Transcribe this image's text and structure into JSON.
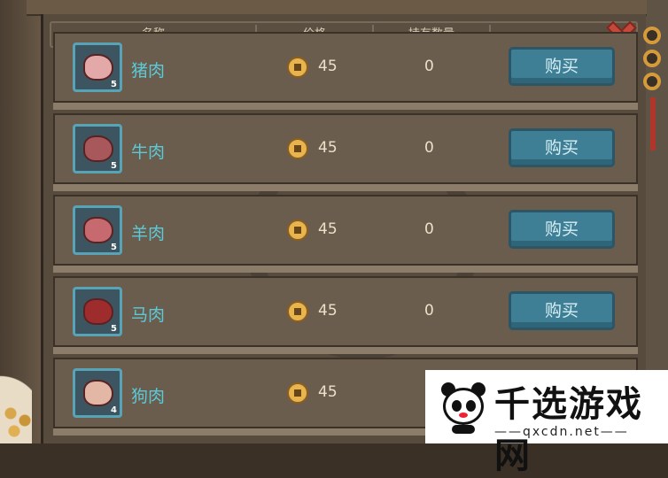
{
  "header": {
    "col_name": "名称",
    "col_price": "价格",
    "col_owned": "持有数量"
  },
  "items": [
    {
      "name": "猪肉",
      "stack": "5",
      "price": "45",
      "owned": "0",
      "buy_label": "购买",
      "meat_color": "#e3a9a9"
    },
    {
      "name": "牛肉",
      "stack": "5",
      "price": "45",
      "owned": "0",
      "buy_label": "购买",
      "meat_color": "#a8585a"
    },
    {
      "name": "羊肉",
      "stack": "5",
      "price": "45",
      "owned": "0",
      "buy_label": "购买",
      "meat_color": "#c66a6f"
    },
    {
      "name": "马肉",
      "stack": "5",
      "price": "45",
      "owned": "0",
      "buy_label": "购买",
      "meat_color": "#9f2c2c"
    },
    {
      "name": "狗肉",
      "stack": "4",
      "price": "45",
      "owned": "",
      "buy_label": "",
      "meat_color": "#e2b7a6"
    }
  ],
  "watermark": {
    "title": "千选游戏网",
    "url": "——qxcdn.net——"
  },
  "colors": {
    "item_name": "#5cc9d8",
    "buy_button": "#3f7f96",
    "panel": "#574b3e"
  },
  "icons": {
    "close": "close-x-icon",
    "coin": "copper-coin-icon"
  }
}
